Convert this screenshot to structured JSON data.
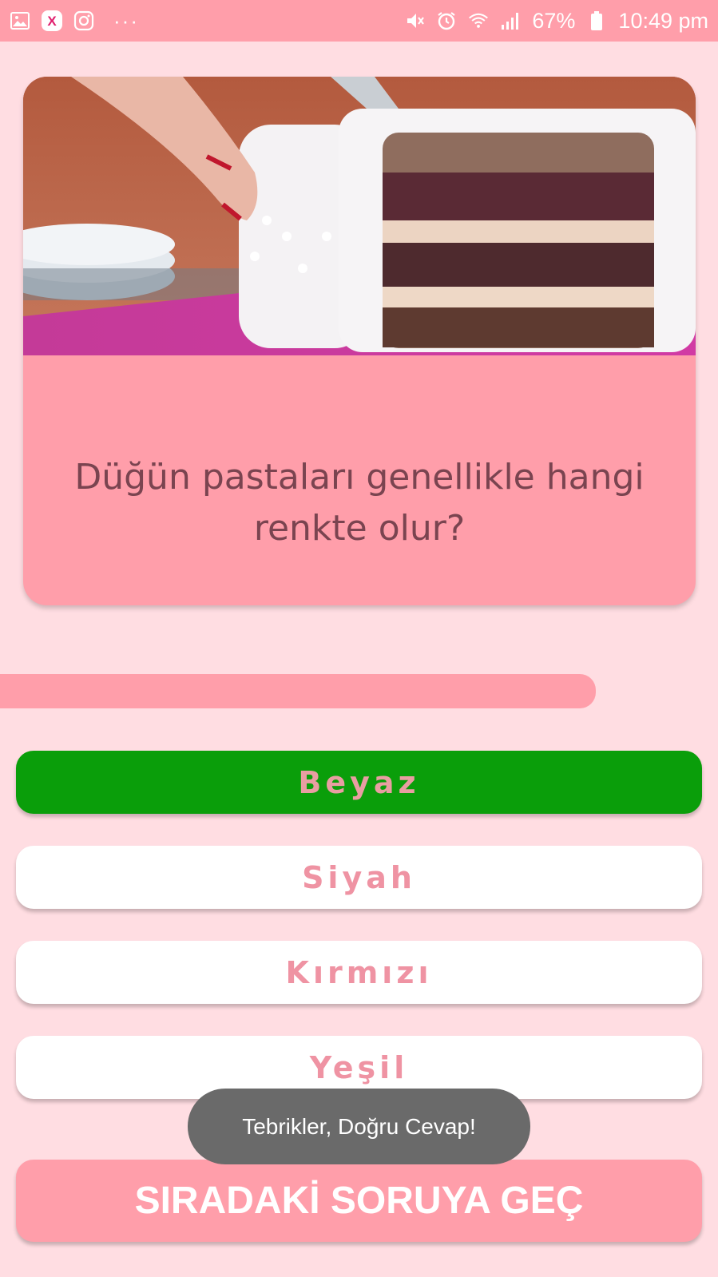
{
  "status_bar": {
    "left_icons": [
      "gallery-icon",
      "app-x-icon",
      "instagram-icon"
    ],
    "overflow": "···",
    "right_icons": [
      "mute-icon",
      "alarm-icon",
      "wifi-icon",
      "signal-icon",
      "battery-icon"
    ],
    "battery": "67%",
    "time": "10:49 pm"
  },
  "question": {
    "image": "wedding-cake-photo",
    "text": "Düğün pastaları genellikle hangi renkte olur?"
  },
  "progress": {
    "fraction": 0.83
  },
  "answers": [
    {
      "label": "Beyaz",
      "state": "correct"
    },
    {
      "label": "Siyah",
      "state": "default"
    },
    {
      "label": "Kırmızı",
      "state": "default"
    },
    {
      "label": "Yeşil",
      "state": "default"
    }
  ],
  "toast": {
    "text": "Tebrikler, Doğru Cevap!"
  },
  "next_button": {
    "label": "SIRADAKİ SORUYA GEÇ"
  },
  "colors": {
    "accent": "#ff9eaa",
    "background": "#ffdde2",
    "correct": "#0a9e0a",
    "answer_text": "#ef93a3",
    "question_text": "#7a4450"
  }
}
